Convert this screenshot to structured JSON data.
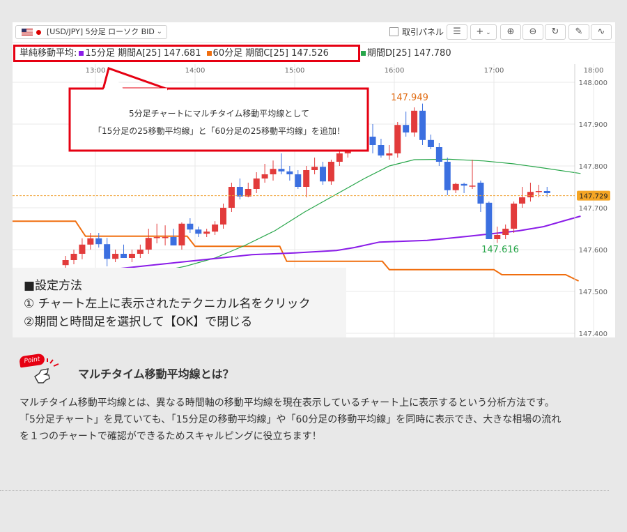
{
  "toolbar": {
    "symbol": "[USD/JPY] 5分足 ローソク BID",
    "trade_panel_label": "取引パネル"
  },
  "indicator_bar": {
    "prefix": "単純移動平均:",
    "entries": [
      {
        "label": "15分足 期間A[25] 147.681",
        "color": "#8a1ce8"
      },
      {
        "label": "60分足 期間C[25] 147.526",
        "color": "#f06e0f"
      },
      {
        "label": "期間D[25] 147.780",
        "color": "#28a64a"
      }
    ]
  },
  "callout": {
    "line1": "5分足チャートにマルチタイム移動平均線として",
    "line2": "「15分足の25移動平均線」と「60分足の25移動平均線」を追加！"
  },
  "instructions": {
    "heading": "■設定方法",
    "step1": "① チャート左上に表示されたテクニカル名をクリック",
    "step2": "②期間と時間足を選択して【OK】で閉じる"
  },
  "point": {
    "badge": "Point",
    "title": "マルチタイム移動平均線とは？",
    "lines": [
      "マルチタイム移動平均線とは、異なる時間軸の移動平均線を現在表示しているチャート上に表示するという分析方法です。",
      "「5分足チャート」を見ていても､「15分足の移動平均線」や「60分足の移動平均線」を同時に表示でき、大きな相場の流れ",
      "を１つのチャートで確認ができるためスキャルピングに役立ちます！"
    ]
  },
  "chart_data": {
    "type": "candlestick",
    "x_ticks": [
      "13:00",
      "14:00",
      "15:00",
      "16:00",
      "17:00",
      "18:00"
    ],
    "y_ticks": [
      "148.000",
      "147.900",
      "147.800",
      "147.700",
      "147.600",
      "147.500",
      "147.400"
    ],
    "ylim": [
      147.4,
      148.0
    ],
    "current_price": "147.729",
    "high_label": "147.949",
    "low_label": "147.616",
    "colors": {
      "up": "#e23b3b",
      "down": "#3b6fe0",
      "ma15": "#8a1ce8",
      "ma60": "#f06e0f",
      "maD": "#28a64a"
    },
    "candles": [
      {
        "o": 147.563,
        "h": 147.585,
        "l": 147.54,
        "c": 147.575
      },
      {
        "o": 147.575,
        "h": 147.6,
        "l": 147.565,
        "c": 147.59
      },
      {
        "o": 147.59,
        "h": 147.627,
        "l": 147.577,
        "c": 147.612
      },
      {
        "o": 147.612,
        "h": 147.64,
        "l": 147.6,
        "c": 147.627
      },
      {
        "o": 147.627,
        "h": 147.64,
        "l": 147.605,
        "c": 147.613
      },
      {
        "o": 147.613,
        "h": 147.628,
        "l": 147.56,
        "c": 147.578
      },
      {
        "o": 147.578,
        "h": 147.6,
        "l": 147.57,
        "c": 147.59
      },
      {
        "o": 147.59,
        "h": 147.612,
        "l": 147.58,
        "c": 147.58
      },
      {
        "o": 147.58,
        "h": 147.6,
        "l": 147.57,
        "c": 147.59
      },
      {
        "o": 147.59,
        "h": 147.612,
        "l": 147.58,
        "c": 147.6
      },
      {
        "o": 147.6,
        "h": 147.65,
        "l": 147.59,
        "c": 147.628
      },
      {
        "o": 147.628,
        "h": 147.662,
        "l": 147.615,
        "c": 147.63
      },
      {
        "o": 147.63,
        "h": 147.658,
        "l": 147.61,
        "c": 147.63
      },
      {
        "o": 147.63,
        "h": 147.65,
        "l": 147.61,
        "c": 147.61
      },
      {
        "o": 147.61,
        "h": 147.665,
        "l": 147.6,
        "c": 147.662
      },
      {
        "o": 147.662,
        "h": 147.675,
        "l": 147.64,
        "c": 147.648
      },
      {
        "o": 147.648,
        "h": 147.655,
        "l": 147.63,
        "c": 147.638
      },
      {
        "o": 147.638,
        "h": 147.65,
        "l": 147.63,
        "c": 147.643
      },
      {
        "o": 147.643,
        "h": 147.668,
        "l": 147.635,
        "c": 147.66
      },
      {
        "o": 147.66,
        "h": 147.71,
        "l": 147.65,
        "c": 147.7
      },
      {
        "o": 147.7,
        "h": 147.76,
        "l": 147.69,
        "c": 147.75
      },
      {
        "o": 147.75,
        "h": 147.77,
        "l": 147.72,
        "c": 147.727
      },
      {
        "o": 147.727,
        "h": 147.76,
        "l": 147.725,
        "c": 147.745
      },
      {
        "o": 147.745,
        "h": 147.785,
        "l": 147.735,
        "c": 147.77
      },
      {
        "o": 147.77,
        "h": 147.805,
        "l": 147.76,
        "c": 147.78
      },
      {
        "o": 147.78,
        "h": 147.813,
        "l": 147.765,
        "c": 147.793
      },
      {
        "o": 147.793,
        "h": 147.83,
        "l": 147.78,
        "c": 147.787
      },
      {
        "o": 147.787,
        "h": 147.8,
        "l": 147.765,
        "c": 147.78
      },
      {
        "o": 147.78,
        "h": 147.79,
        "l": 147.745,
        "c": 147.75
      },
      {
        "o": 147.75,
        "h": 147.8,
        "l": 147.725,
        "c": 147.79
      },
      {
        "o": 147.79,
        "h": 147.82,
        "l": 147.78,
        "c": 147.798
      },
      {
        "o": 147.798,
        "h": 147.81,
        "l": 147.755,
        "c": 147.763
      },
      {
        "o": 147.763,
        "h": 147.815,
        "l": 147.755,
        "c": 147.81
      },
      {
        "o": 147.81,
        "h": 147.86,
        "l": 147.8,
        "c": 147.83
      },
      {
        "o": 147.83,
        "h": 147.87,
        "l": 147.82,
        "c": 147.858
      },
      {
        "o": 147.858,
        "h": 147.9,
        "l": 147.838,
        "c": 147.855
      },
      {
        "o": 147.855,
        "h": 147.89,
        "l": 147.84,
        "c": 147.87
      },
      {
        "o": 147.87,
        "h": 147.9,
        "l": 147.83,
        "c": 147.85
      },
      {
        "o": 147.85,
        "h": 147.865,
        "l": 147.82,
        "c": 147.825
      },
      {
        "o": 147.825,
        "h": 147.85,
        "l": 147.815,
        "c": 147.83
      },
      {
        "o": 147.83,
        "h": 147.905,
        "l": 147.82,
        "c": 147.898
      },
      {
        "o": 147.898,
        "h": 147.93,
        "l": 147.87,
        "c": 147.88
      },
      {
        "o": 147.88,
        "h": 147.94,
        "l": 147.87,
        "c": 147.932
      },
      {
        "o": 147.932,
        "h": 147.949,
        "l": 147.85,
        "c": 147.862
      },
      {
        "o": 147.862,
        "h": 147.875,
        "l": 147.84,
        "c": 147.845
      },
      {
        "o": 147.845,
        "h": 147.855,
        "l": 147.8,
        "c": 147.81
      },
      {
        "o": 147.81,
        "h": 147.82,
        "l": 147.73,
        "c": 147.742
      },
      {
        "o": 147.742,
        "h": 147.76,
        "l": 147.735,
        "c": 147.757
      },
      {
        "o": 147.757,
        "h": 147.76,
        "l": 147.735,
        "c": 147.753
      },
      {
        "o": 147.753,
        "h": 147.815,
        "l": 147.745,
        "c": 147.753
      },
      {
        "o": 147.76,
        "h": 147.765,
        "l": 147.69,
        "c": 147.71
      },
      {
        "o": 147.712,
        "h": 147.715,
        "l": 147.625,
        "c": 147.625
      },
      {
        "o": 147.625,
        "h": 147.655,
        "l": 147.616,
        "c": 147.635
      },
      {
        "o": 147.635,
        "h": 147.66,
        "l": 147.625,
        "c": 147.65
      },
      {
        "o": 147.65,
        "h": 147.715,
        "l": 147.64,
        "c": 147.71
      },
      {
        "o": 147.71,
        "h": 147.75,
        "l": 147.7,
        "c": 147.725
      },
      {
        "o": 147.725,
        "h": 147.76,
        "l": 147.715,
        "c": 147.738
      },
      {
        "o": 147.738,
        "h": 147.755,
        "l": 147.725,
        "c": 147.74
      },
      {
        "o": 147.74,
        "h": 147.75,
        "l": 147.726,
        "c": 147.735
      }
    ],
    "ma15": [
      [
        12.55,
        147.54
      ],
      [
        12.97,
        147.548
      ],
      [
        13.37,
        147.558
      ],
      [
        13.77,
        147.568
      ],
      [
        14.17,
        147.578
      ],
      [
        14.57,
        147.588
      ],
      [
        15.0,
        147.592
      ],
      [
        15.42,
        147.598
      ],
      [
        15.6,
        147.605
      ],
      [
        15.85,
        147.618
      ],
      [
        16.33,
        147.622
      ],
      [
        16.75,
        147.632
      ],
      [
        17.25,
        147.645
      ],
      [
        17.5,
        147.655
      ],
      [
        17.72,
        147.67
      ],
      [
        17.87,
        147.68
      ]
    ],
    "ma60": [
      [
        12.0,
        147.668
      ],
      [
        12.8,
        147.668
      ],
      [
        12.9,
        147.632
      ],
      [
        13.92,
        147.632
      ],
      [
        14.0,
        147.608
      ],
      [
        14.85,
        147.608
      ],
      [
        14.92,
        147.572
      ],
      [
        15.88,
        147.572
      ],
      [
        15.95,
        147.552
      ],
      [
        17.0,
        147.552
      ],
      [
        17.08,
        147.54
      ],
      [
        17.72,
        147.54
      ],
      [
        17.85,
        147.525
      ]
    ],
    "maD": [
      [
        13.58,
        147.545
      ],
      [
        13.9,
        147.56
      ],
      [
        14.2,
        147.58
      ],
      [
        14.5,
        147.61
      ],
      [
        14.8,
        147.645
      ],
      [
        15.1,
        147.69
      ],
      [
        15.4,
        147.73
      ],
      [
        15.7,
        147.77
      ],
      [
        15.95,
        147.8
      ],
      [
        16.2,
        147.815
      ],
      [
        16.55,
        147.816
      ],
      [
        16.9,
        147.812
      ],
      [
        17.2,
        147.805
      ],
      [
        17.5,
        147.795
      ],
      [
        17.87,
        147.782
      ]
    ]
  }
}
